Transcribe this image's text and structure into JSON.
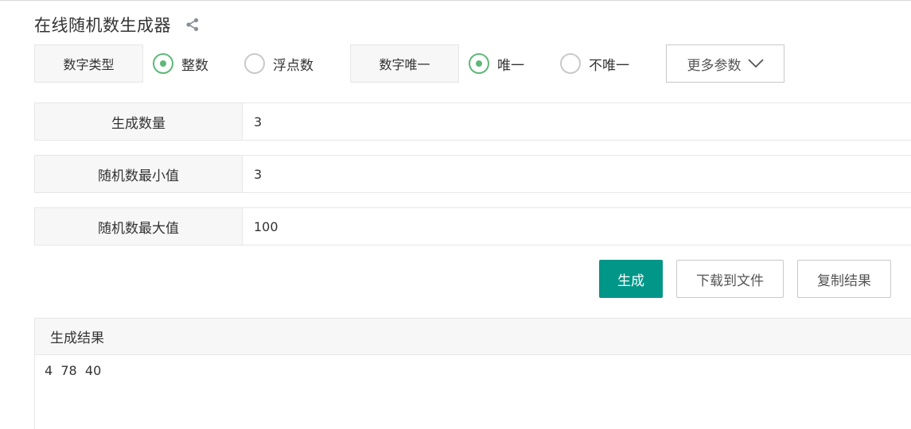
{
  "page": {
    "title": "在线随机数生成器",
    "share_icon": "share-icon"
  },
  "options": {
    "number_type": {
      "label": "数字类型",
      "choices": [
        {
          "label": "整数",
          "checked": true
        },
        {
          "label": "浮点数",
          "checked": false
        }
      ]
    },
    "unique": {
      "label": "数字唯一",
      "choices": [
        {
          "label": "唯一",
          "checked": true
        },
        {
          "label": "不唯一",
          "checked": false
        }
      ]
    },
    "more_params": {
      "label": "更多参数",
      "icon": "chevron-down-icon"
    }
  },
  "fields": {
    "count": {
      "label": "生成数量",
      "value": "3"
    },
    "min": {
      "label": "随机数最小值",
      "value": "3"
    },
    "max": {
      "label": "随机数最大值",
      "value": "100"
    }
  },
  "actions": {
    "generate": "生成",
    "download": "下载到文件",
    "copy": "复制结果"
  },
  "result": {
    "header": "生成结果",
    "text": "4  78  40"
  },
  "colors": {
    "primary": "#009688",
    "radio_checked": "#5fb878",
    "label_bg": "#f7f7f7",
    "border": "#e6e6e6"
  }
}
